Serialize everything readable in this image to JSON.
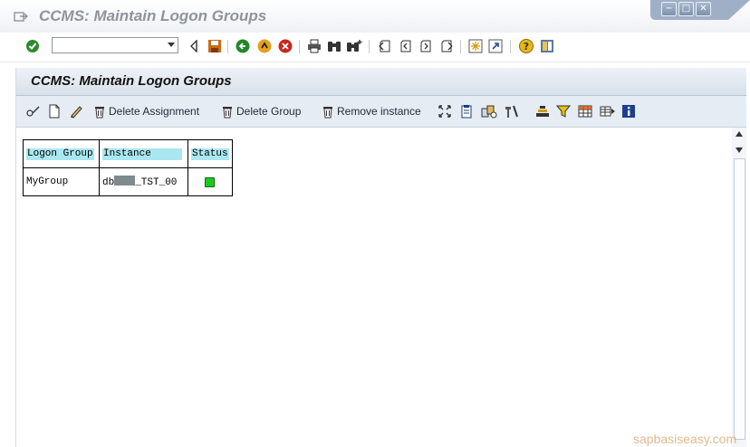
{
  "window": {
    "title": "CCMS: Maintain Logon Groups",
    "controls": {
      "minimize": "−",
      "maximize": "□",
      "close": "✕"
    }
  },
  "command_field": {
    "value": ""
  },
  "app": {
    "title": "CCMS: Maintain Logon Groups",
    "toolbar": {
      "delete_assignment": "Delete Assignment",
      "delete_group": "Delete Group",
      "remove_instance": "Remove instance"
    }
  },
  "table": {
    "headers": {
      "logon_group": "Logon Group",
      "instance": "Instance",
      "status": "Status"
    },
    "rows": [
      {
        "logon_group": "MyGroup",
        "instance_prefix": "db",
        "instance_suffix": "_TST_00",
        "status": "green"
      }
    ]
  },
  "watermark": "sapbasiseasy.com",
  "colors": {
    "header_highlight": "#a9e7f1",
    "status_green": "#1fc61f"
  }
}
